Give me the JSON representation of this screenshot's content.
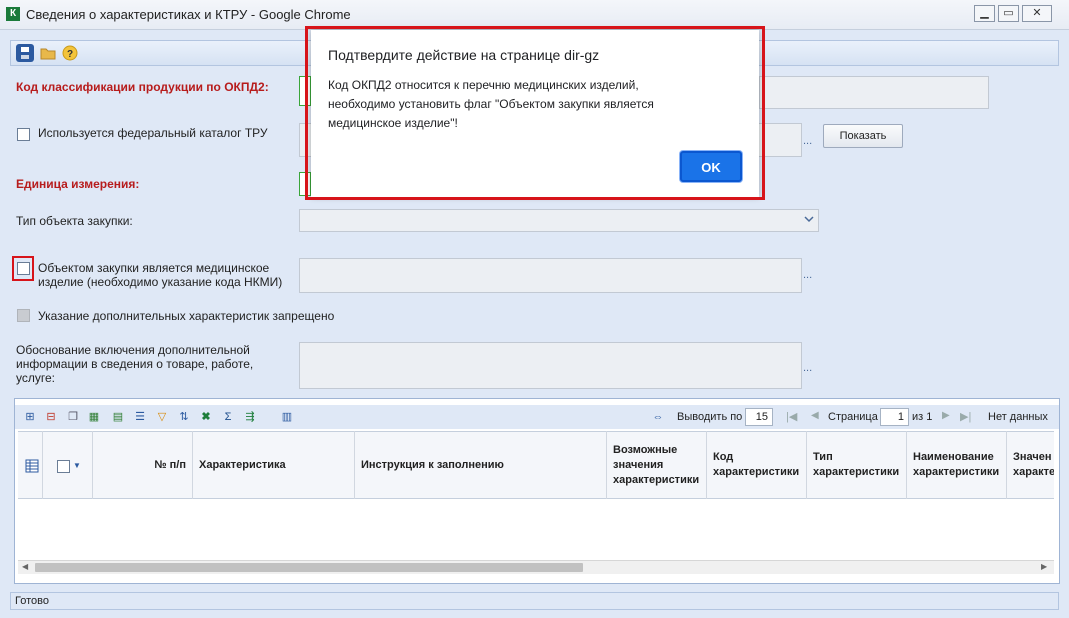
{
  "window": {
    "title": "Сведения о характеристиках и КТРУ - Google Chrome",
    "app_icon_letter": "К",
    "controls": [
      "▁",
      "▭",
      "✕"
    ]
  },
  "toolbar": {
    "icons": [
      "save-icon",
      "open-folder-icon",
      "help-icon"
    ]
  },
  "form": {
    "okpd_label": "Код классификации продукции по ОКПД2:",
    "federal_catalog_label": "Используется федеральный каталог ТРУ",
    "show_button": "Показать",
    "unit_label": "Единица измерения:",
    "purchase_type_label": "Тип объекта закупки:",
    "medical_label": "Объектом закупки является медицинское\nизделие (необходимо указание кода НКМИ)",
    "extra_forbidden_label": "Указание дополнительных характеристик запрещено",
    "reason_label": "Обоснование включения дополнительной\nинформации в сведения о товаре, работе,\nуслуге:",
    "ellipsis": "..."
  },
  "grid": {
    "pager": {
      "show_label": "Выводить по",
      "page_size": "15",
      "page_label": "Страница",
      "page": "1",
      "of_label": "из 1",
      "no_data": "Нет данных"
    },
    "columns": [
      "№ п/п",
      "Характеристика",
      "Инструкция к заполнению",
      "Возможные\nзначения\nхарактеристики",
      "Код\nхарактеристики",
      "Тип\nхарактеристики",
      "Наименование\nхарактеристики",
      "Значен\nхаракте"
    ]
  },
  "status": {
    "text": "Готово"
  },
  "dialog": {
    "title": "Подтвердите действие на странице dir-gz",
    "message": "Код ОКПД2 относится к перечню медицинских изделий,\nнеобходимо установить флаг \"Объектом закупки является\nмедицинское изделие\"!",
    "ok": "OK"
  },
  "colors": {
    "highlight": "#d7141a",
    "ok_button": "#1a73e8",
    "label_required": "#b71c1c"
  }
}
